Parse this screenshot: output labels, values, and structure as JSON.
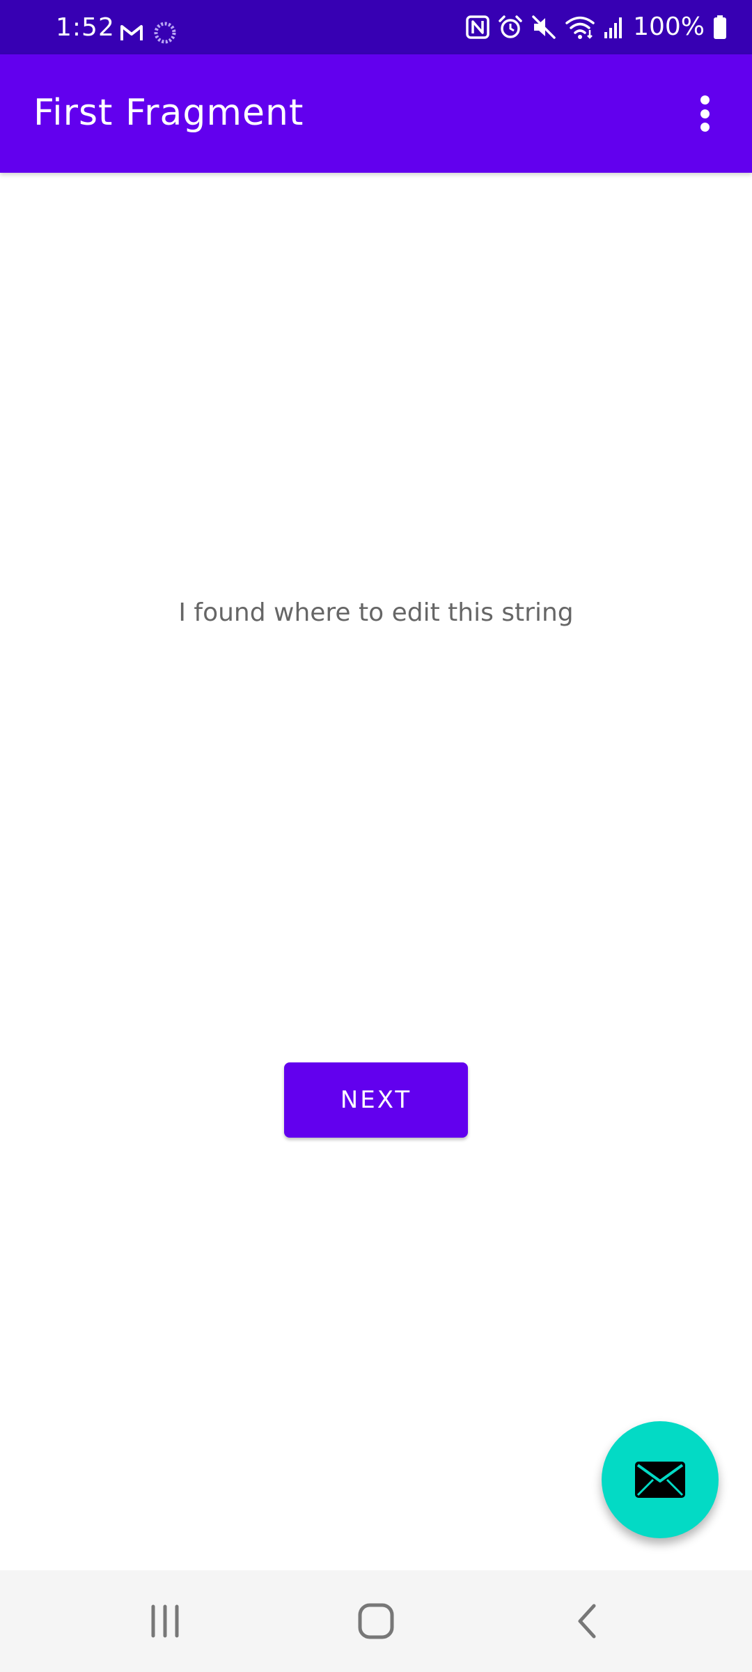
{
  "status_bar": {
    "time": "1:52",
    "battery_percent": "100%",
    "left_icons": [
      "gmail-icon",
      "sync-icon"
    ],
    "right_icons": [
      "nfc-icon",
      "alarm-icon",
      "mute-icon",
      "wifi-icon",
      "signal-icon",
      "battery-icon"
    ],
    "background": "#3700B3"
  },
  "app_bar": {
    "title": "First Fragment",
    "overflow_icon": "more-vert-icon",
    "background": "#6200EE"
  },
  "content": {
    "message": "I found where to edit this string"
  },
  "next_button": {
    "label": "NEXT",
    "color": "#6200EE"
  },
  "fab": {
    "icon": "email-icon",
    "color": "#03DAC5"
  },
  "nav_bar": {
    "buttons": [
      "recent-apps-icon",
      "home-icon",
      "back-icon"
    ]
  }
}
